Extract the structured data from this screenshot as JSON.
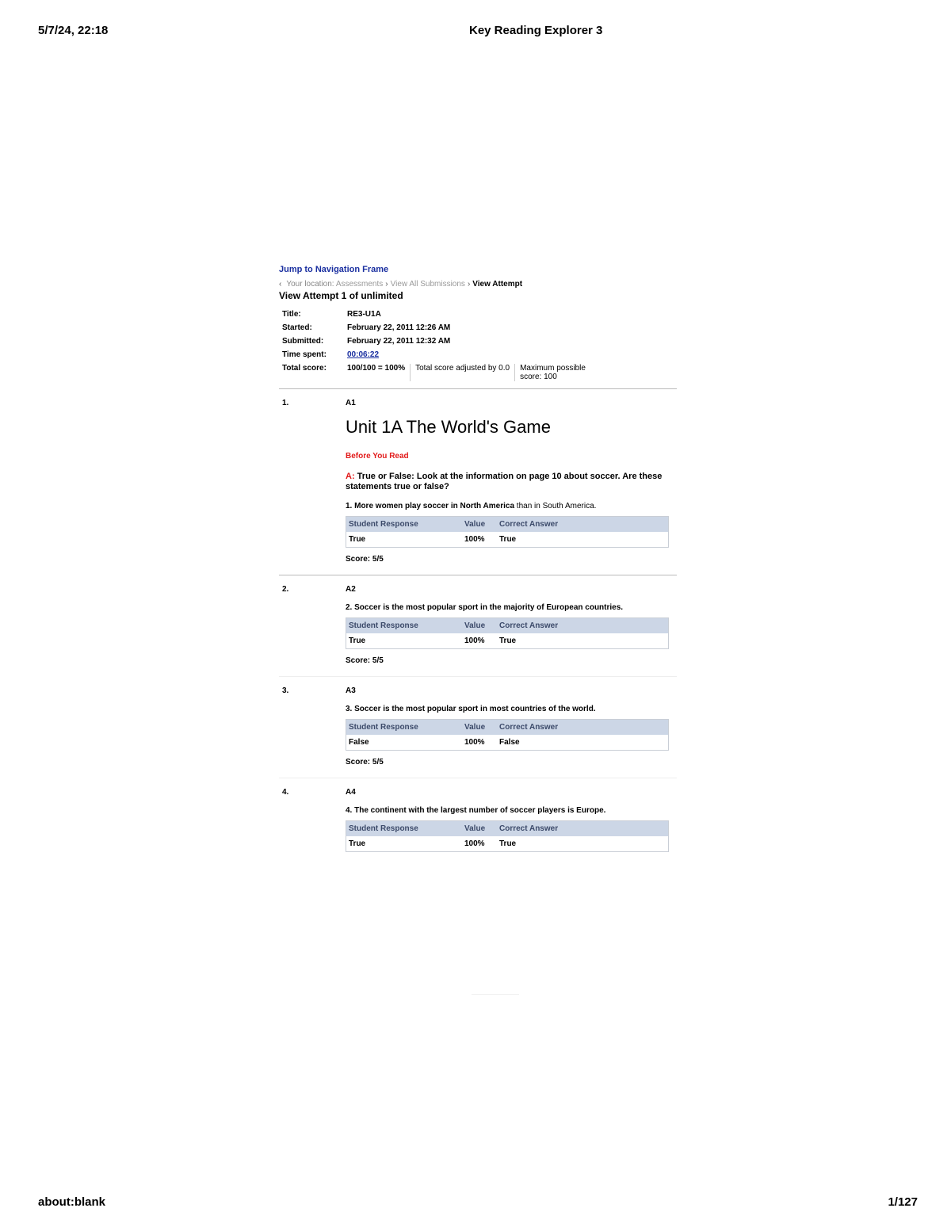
{
  "page_header": {
    "datetime": "5/7/24, 22:18",
    "title": "Key Reading Explorer 3"
  },
  "page_footer": {
    "url": "about:blank",
    "page": "1/127"
  },
  "nav": {
    "jump_link": "Jump to Navigation Frame",
    "back_arrow": "‹",
    "location_label": "Your location:",
    "crumbs": [
      "Assessments",
      "View All Submissions"
    ],
    "sep": "›",
    "current": "View Attempt"
  },
  "attempt": {
    "heading": "View Attempt 1 of unlimited",
    "title_label": "Title:",
    "title_value": "RE3-U1A",
    "started_label": "Started:",
    "started_value": "February 22, 2011 12:26 AM",
    "submitted_label": "Submitted:",
    "submitted_value": "February 22, 2011 12:32 AM",
    "time_label": "Time spent:",
    "time_value": "00:06:22",
    "total_label": "Total score:",
    "total_value": "100/100 = 100%",
    "adjusted_text": "Total score adjusted by 0.0",
    "max_text": "Maximum possible score: 100"
  },
  "unit": {
    "title": "Unit 1A The World's Game",
    "before_read": "Before You Read",
    "instruction_prefix": "A:",
    "instruction": "True or False: Look at the information on page 10 about soccer. Are these statements true or false?"
  },
  "response_headers": {
    "student": "Student Response",
    "value": "Value",
    "correct": "Correct Answer"
  },
  "questions": [
    {
      "num": "1.",
      "code": "A1",
      "prompt_bold": "1. More women play soccer in North America",
      "prompt_light": " than in South America.",
      "response": "True",
      "value": "100%",
      "correct": "True",
      "score": "Score: 5/5"
    },
    {
      "num": "2.",
      "code": "A2",
      "prompt_bold": "2. Soccer is the most popular sport in the majority of European countries.",
      "prompt_light": "",
      "response": "True",
      "value": "100%",
      "correct": "True",
      "score": "Score: 5/5"
    },
    {
      "num": "3.",
      "code": "A3",
      "prompt_bold": "3. Soccer is the most popular sport in most countries of the world.",
      "prompt_light": "",
      "response": "False",
      "value": "100%",
      "correct": "False",
      "score": "Score:  5/5"
    },
    {
      "num": "4.",
      "code": "A4",
      "prompt_bold": "4. The continent with the largest number of soccer players is Europe.",
      "prompt_light": "",
      "response": "True",
      "value": "100%",
      "correct": "True",
      "score": ""
    }
  ]
}
